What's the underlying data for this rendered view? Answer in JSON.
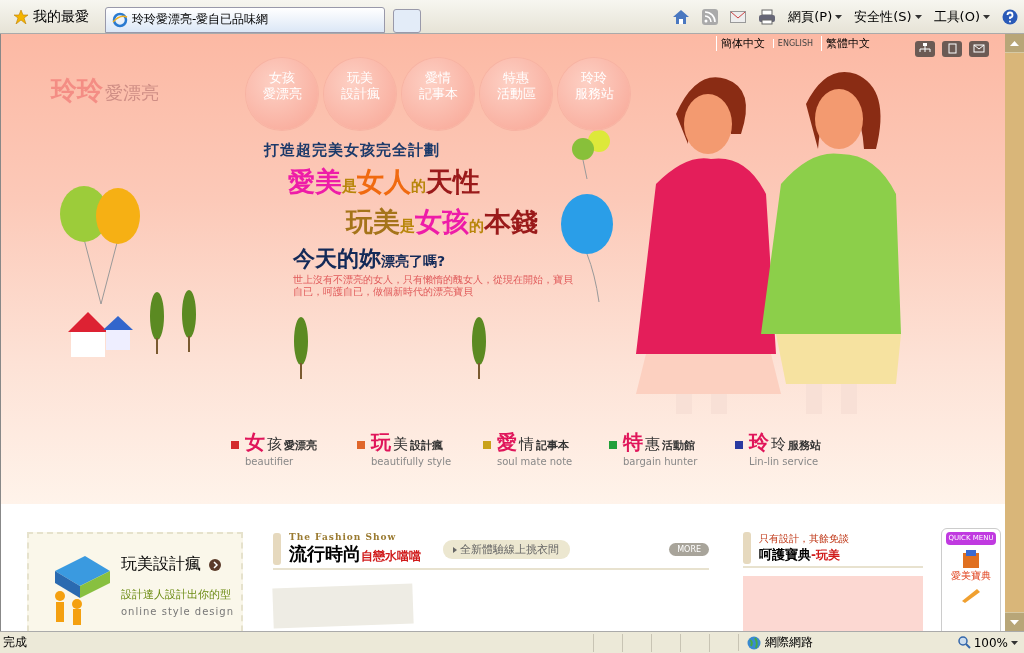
{
  "browser": {
    "favorites": "我的最愛",
    "tab_title": "玲玲愛漂亮-愛自已品味網",
    "menus": [
      "網頁(P)",
      "安全性(S)",
      "工具(O)"
    ]
  },
  "header": {
    "logo_main": "玲玲",
    "logo_sub": "愛漂亮",
    "languages": [
      "簡体中文",
      "ENGLISH",
      "繁體中文"
    ],
    "nav": [
      {
        "line1": "女孩",
        "line2": "愛漂亮"
      },
      {
        "line1": "玩美",
        "line2": "設計瘋"
      },
      {
        "line1": "愛情",
        "line2": "記事本"
      },
      {
        "line1": "特惠",
        "line2": "活動區"
      },
      {
        "line1": "玲玲",
        "line2": "服務站"
      }
    ]
  },
  "hero": {
    "kicker": "打造超完美女孩完全計劃",
    "slogan_1": [
      {
        "text": "愛美",
        "kind": "big",
        "color": "#ee1ca8"
      },
      {
        "text": "是",
        "kind": "small",
        "color": "#b8860b"
      },
      {
        "text": "女人",
        "kind": "big",
        "color": "#f06a10"
      },
      {
        "text": "的",
        "kind": "small",
        "color": "#b8860b"
      },
      {
        "text": "天性",
        "kind": "big",
        "color": "#9a1a1a"
      }
    ],
    "slogan_2": [
      {
        "text": "玩美",
        "kind": "big",
        "color": "#a5741a"
      },
      {
        "text": "是",
        "kind": "small",
        "color": "#b8860b"
      },
      {
        "text": "女孩",
        "kind": "big",
        "color": "#ee1ca8"
      },
      {
        "text": "的",
        "kind": "small",
        "color": "#b8860b"
      },
      {
        "text": "本錢",
        "kind": "big",
        "color": "#9a1a1a"
      }
    ],
    "question_big": "今天的妳",
    "question_small": "漂亮了嗎?",
    "body": "世上沒有不漂亮的女人，只有懶惰的醜女人，從現在開始，寶貝自已，呵護自已，做個新時代的漂亮寶貝"
  },
  "categories": [
    {
      "big": "女",
      "mid": "孩",
      "small": "愛漂亮",
      "english": "beautifier",
      "color": "#d42a2a"
    },
    {
      "big": "玩",
      "mid": "美",
      "small": "設計瘋",
      "english": "beautifully style",
      "color": "#e0662a"
    },
    {
      "big": "愛",
      "mid": "情",
      "small": "記事本",
      "english": "soul mate note",
      "color": "#c9a21a"
    },
    {
      "big": "特",
      "mid": "惠",
      "small": "活動館",
      "english": "bargain hunter",
      "color": "#22a03a"
    },
    {
      "big": "玲",
      "mid": "玲",
      "small": "服務站",
      "english": "Lin-lin service",
      "color": "#2a3aa0"
    }
  ],
  "promo": {
    "title": "玩美設計瘋",
    "subtitle": "設計達人設計出你的型",
    "english": "online style design"
  },
  "fashion": {
    "kicker": "The Fashion Show",
    "title": "流行時尚",
    "tag": "自戀水噹噹",
    "link": "全新體驗線上挑衣間",
    "more": "MORE"
  },
  "care": {
    "kicker": "只有設計，其餘免談",
    "title": "呵護寶典",
    "tag": "-玩美"
  },
  "quick_menu": {
    "label": "QUICK MENU",
    "items": [
      "愛美寶典"
    ]
  },
  "status_bar": {
    "text": "完成",
    "zone": "網際網路",
    "zoom": "100%"
  }
}
